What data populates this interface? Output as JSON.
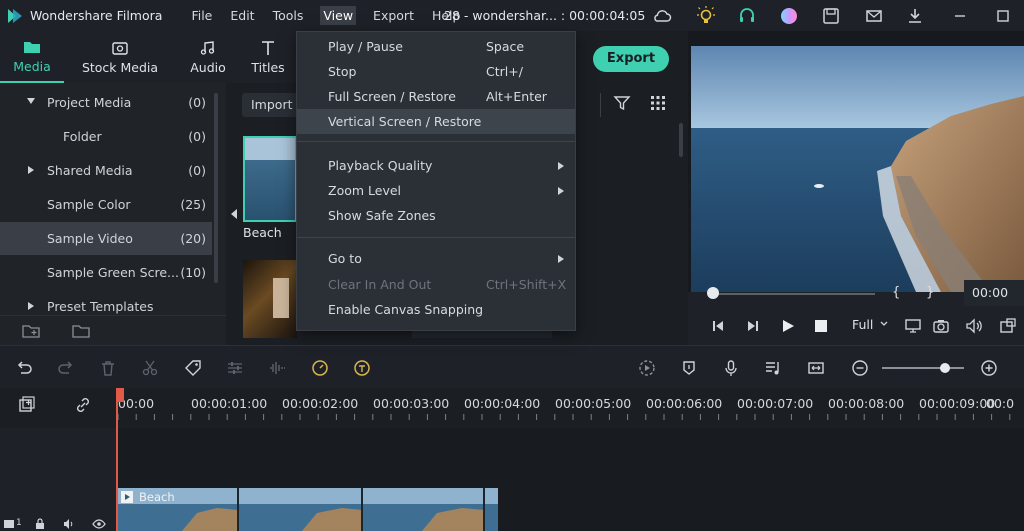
{
  "app": {
    "name": "Wondershare Filmora",
    "project_title": "28 - wondershar... : 00:00:04:05"
  },
  "menubar": [
    "File",
    "Edit",
    "Tools",
    "View",
    "Export",
    "Help"
  ],
  "tabs": [
    {
      "label": "Media",
      "icon": "folder-icon",
      "active": true
    },
    {
      "label": "Stock Media",
      "icon": "stock-media-icon",
      "active": false
    },
    {
      "label": "Audio",
      "icon": "music-note-icon",
      "active": false
    },
    {
      "label": "Titles",
      "icon": "text-t-icon",
      "active": false
    }
  ],
  "left_panel": {
    "items": [
      {
        "label": "Project Media",
        "count": "(0)",
        "expandable": "down"
      },
      {
        "label": "Folder",
        "count": "(0)"
      },
      {
        "label": "Shared Media",
        "count": "(0)",
        "expandable": "right"
      },
      {
        "label": "Sample Color",
        "count": "(25)"
      },
      {
        "label": "Sample Video",
        "count": "(20)",
        "selected": true
      },
      {
        "label": "Sample Green Scre...",
        "count": "(10)"
      },
      {
        "label": "Preset Templates",
        "count": "",
        "expandable": "right"
      }
    ]
  },
  "media": {
    "import_label": "Import",
    "thumbs": [
      {
        "label": "Beach"
      }
    ]
  },
  "export_label": "Export",
  "view_menu": {
    "items": [
      {
        "label": "Play / Pause",
        "shortcut": "Space"
      },
      {
        "label": "Stop",
        "shortcut": "Ctrl+/"
      },
      {
        "label": "Full Screen / Restore",
        "shortcut": "Alt+Enter"
      },
      {
        "label": "Vertical Screen / Restore",
        "shortcut": "",
        "highlighted": true
      },
      {
        "label": "Playback Quality",
        "submenu": true
      },
      {
        "label": "Zoom Level",
        "submenu": true
      },
      {
        "label": "Show Safe Zones"
      },
      {
        "label": "Go to",
        "submenu": true
      },
      {
        "label": "Clear In And Out",
        "shortcut": "Ctrl+Shift+X",
        "disabled": true
      },
      {
        "label": "Enable Canvas Snapping"
      }
    ]
  },
  "preview": {
    "timecode": "00:00",
    "quality": "Full",
    "braces": [
      "{",
      "}"
    ]
  },
  "timeline": {
    "ruler_labels": [
      "00:00",
      "00:00:01:00",
      "00:00:02:00",
      "00:00:03:00",
      "00:00:04:00",
      "00:00:05:00",
      "00:00:06:00",
      "00:00:07:00",
      "00:00:08:00",
      "00:00:09:00",
      "00:0"
    ],
    "clip_label": "Beach",
    "track_number": "1"
  },
  "colors": {
    "accent": "#3fd0b2",
    "playhead": "#e05a47",
    "bg": "#1b1f24",
    "menu_bg": "#2b3037"
  }
}
